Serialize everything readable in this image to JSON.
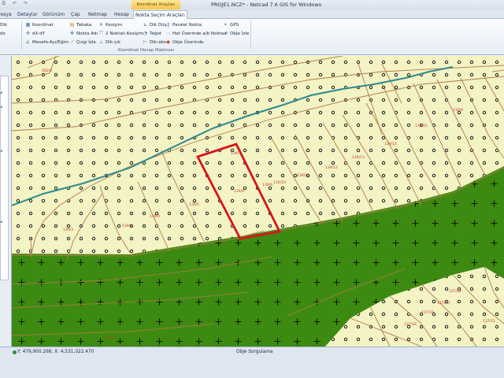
{
  "window": {
    "title": "PROJE1.NCZ* - Netcad 7.6 GIS for Windows",
    "context_header": "Koordinat Araçları"
  },
  "tabs": [
    {
      "label": "Dosya"
    },
    {
      "label": "Detaylar"
    },
    {
      "label": "Görünüm"
    },
    {
      "label": "Çap"
    },
    {
      "label": "Netmap"
    },
    {
      "label": "Hesap"
    },
    {
      "label": "Nokta Seçim Araçları"
    }
  ],
  "ribbon": {
    "group_label": "Koordinat Hesap Makinası",
    "left_labels": [
      "Dik",
      "dx"
    ],
    "col1": [
      "Koordinat",
      "dX-dY",
      "Mesafe-Açı/Eğim"
    ],
    "col2": [
      "Tabaka",
      "Nokta Adı",
      "Çizgi İzle"
    ],
    "col3": [
      "Kesişim",
      "2 Noktalı Kesişim",
      "Dik-çık"
    ],
    "col4": [
      "Dik Düş",
      "Teğet",
      "Dik-abs"
    ],
    "col5": [
      "Paralel Nokta",
      "Hat Üzerinde a/b Noktası",
      "Obje Üzerinde"
    ],
    "col6": [
      "GPS",
      "Obje İzle"
    ]
  },
  "map": {
    "parcel_labels": [
      "002/6",
      "139/3",
      "139/2",
      "139/4",
      "139/5",
      "139/6",
      "139/7",
      "139/9",
      "139/10",
      "139/11",
      "139/12",
      "139/13",
      "139/14",
      "139/15",
      "139/8",
      "137/22",
      "137/20",
      "137/19",
      "137/18",
      "137/21",
      "137/3"
    ],
    "colors": {
      "background": "#f3f3c4",
      "forest": "#3d8a12",
      "parcel_line": "#b47a4a",
      "selection": "#d6141a",
      "river": "#2e8a8e"
    }
  },
  "status": {
    "coordinates": "Y: 479,900.268, X: 4,531,022.470",
    "mode": "Obje Sorgulama"
  }
}
